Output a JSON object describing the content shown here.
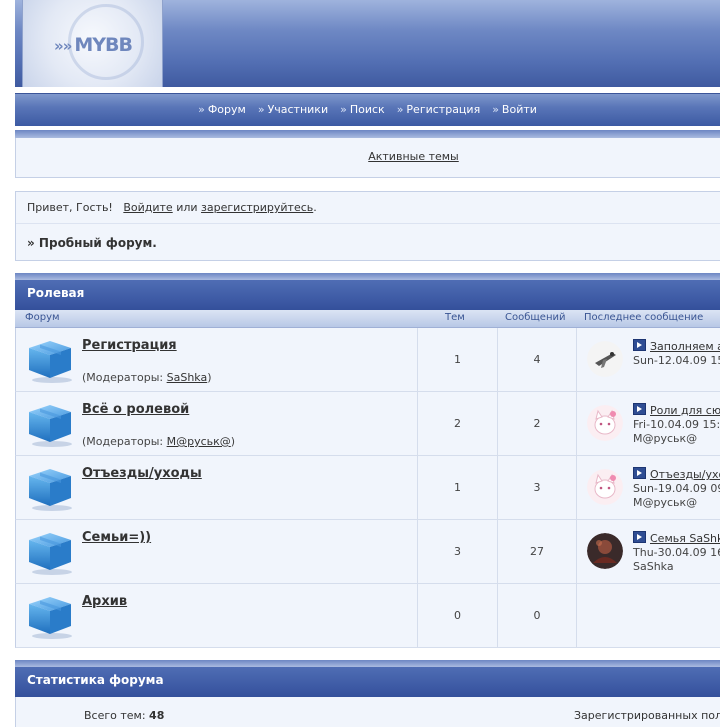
{
  "logo": {
    "text": "MYBB"
  },
  "nav": [
    {
      "label": "Форум"
    },
    {
      "label": "Участники"
    },
    {
      "label": "Поиск"
    },
    {
      "label": "Регистрация"
    },
    {
      "label": "Войти"
    }
  ],
  "active_topics": "Активные темы",
  "welcome": {
    "greeting": "Привет, Гость!",
    "login": "Войдите",
    "or": "или",
    "register": "зарегистрируйтесь",
    "period": "."
  },
  "breadcrumb": "» Пробный форум.",
  "category": {
    "title": "Ролевая",
    "columns": {
      "forum": "Форум",
      "topics": "Тем",
      "posts": "Сообщений",
      "last": "Последнее сообщение"
    }
  },
  "forums": [
    {
      "title": "Регистрация",
      "mods_prefix": "(Модераторы: ",
      "mod": "SaShka",
      "mods_suffix": ")",
      "topics": "1",
      "posts": "4",
      "last_topic": "Заполняем а",
      "last_date": "Sun-12.04.09 15",
      "last_user": "",
      "avatar": "plane"
    },
    {
      "title": "Всё о ролевой",
      "mods_prefix": "(Модераторы: ",
      "mod": "М@руськ@",
      "mods_suffix": ")",
      "topics": "2",
      "posts": "2",
      "last_topic": "Роли для сю",
      "last_date": "Fri-10.04.09 15:",
      "last_user": "М@руськ@",
      "avatar": "cat"
    },
    {
      "title": "Отъезды/уходы",
      "mods_prefix": "",
      "mod": "",
      "mods_suffix": "",
      "topics": "1",
      "posts": "3",
      "last_topic": "Отъезды/ухо",
      "last_date": "Sun-19.04.09 09",
      "last_user": "М@руськ@",
      "avatar": "cat"
    },
    {
      "title": "Семьи=))",
      "mods_prefix": "",
      "mod": "",
      "mods_suffix": "",
      "topics": "3",
      "posts": "27",
      "last_topic": "Семья SaShk",
      "last_date": "Thu-30.04.09 16",
      "last_user": "SaShka",
      "avatar": "dark"
    },
    {
      "title": "Архив",
      "mods_prefix": "",
      "mod": "",
      "mods_suffix": "",
      "topics": "0",
      "posts": "0",
      "last_topic": "",
      "last_date": "",
      "last_user": "",
      "avatar": ""
    }
  ],
  "stats": {
    "title": "Статистика форума",
    "topics_label": "Всего тем: ",
    "topics_value": "48",
    "registered_label": "Зарегистрированных пол"
  },
  "colors": {
    "header_blue": "#3f5ca6",
    "panel_bg": "#f1f5fc",
    "link": "#333333"
  }
}
